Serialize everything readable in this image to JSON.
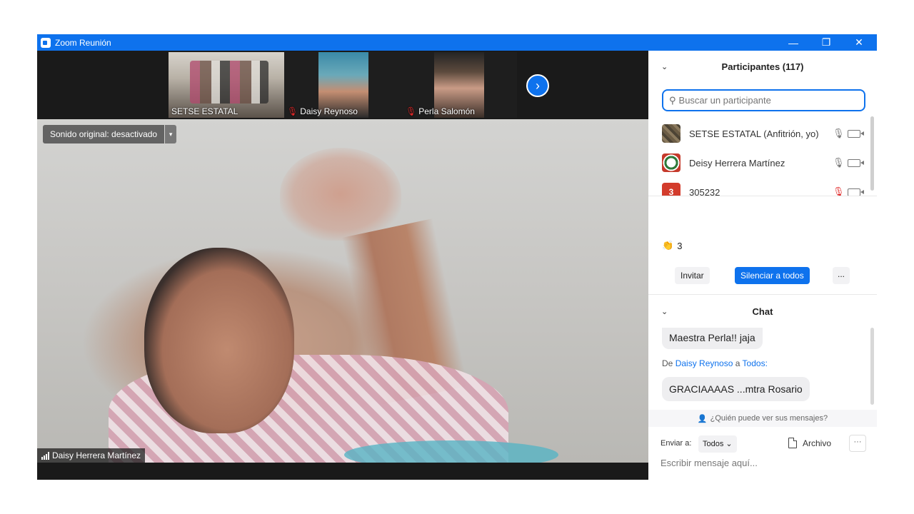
{
  "window": {
    "title": "Zoom Reunión",
    "minimize_glyph": "—",
    "maximize_glyph": "❐",
    "close_glyph": "✕"
  },
  "thumbnails": [
    {
      "name": "SETSE ESTATAL",
      "muted": false
    },
    {
      "name": "Daisy Reynoso",
      "muted": true
    },
    {
      "name": "Perla Salomón",
      "muted": true
    }
  ],
  "next_page_glyph": "›",
  "main_video": {
    "audio_setting": "Sonido original: desactivado",
    "audio_caret": "▾",
    "speaker_name": "Daisy Herrera Martínez"
  },
  "participants": {
    "header": "Participantes (117)",
    "collapse_glyph": "⌄",
    "search_placeholder": "Buscar un participante",
    "search_glyph": "⚲",
    "list": [
      {
        "name": "SETSE ESTATAL (Anfitrión, yo)",
        "avatar": "photo",
        "mic": "unmuted"
      },
      {
        "name": "Deisy Herrera Martínez",
        "avatar": "logo",
        "mic": "unmuted"
      },
      {
        "name": "305232",
        "avatar_letter": "3",
        "mic": "muted"
      }
    ],
    "mic_glyph": "🎙",
    "reaction": {
      "glyph": "👏",
      "count": "3"
    },
    "invite_label": "Invitar",
    "mute_all_label": "Silenciar a todos",
    "more_label": "..."
  },
  "chat": {
    "header": "Chat",
    "collapse_glyph": "⌄",
    "messages": [
      {
        "text": "Maestra Perla!! jaja"
      },
      {
        "from_prefix": "De",
        "from": "Daisy Reynoso",
        "to_prefix": "a",
        "to": "Todos:",
        "text": "GRACIAAAAS ...mtra Rosario"
      }
    ],
    "who_can_see": "¿Quién puede ver sus mensajes?",
    "who_glyph": "👤",
    "send_to_label": "Enviar a:",
    "send_to_value": "Todos",
    "send_to_caret": "⌄",
    "file_label": "Archivo",
    "more_label": "···",
    "input_placeholder": "Escribir mensaje aquí..."
  },
  "colors": {
    "accent": "#0e72ed",
    "muted_red": "#e02828",
    "video_bg": "#1a1a1a"
  }
}
